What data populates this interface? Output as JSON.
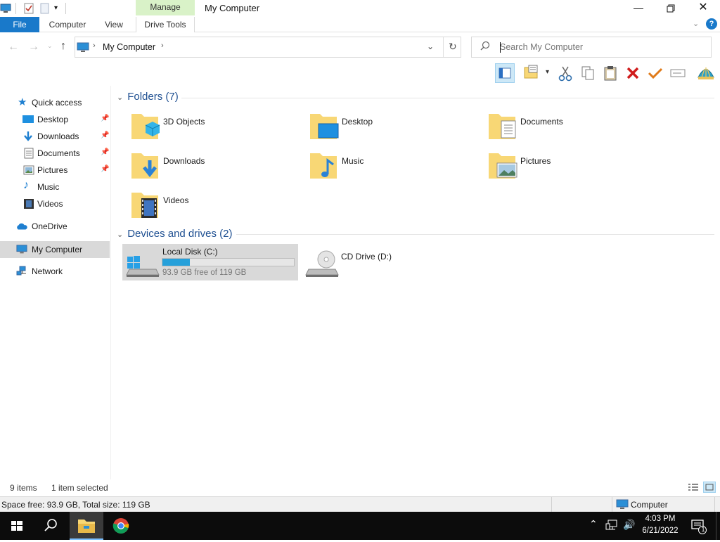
{
  "titlebar": {
    "context_tab": "Manage",
    "title": "My Computer"
  },
  "ribbon": {
    "file": "File",
    "tabs": [
      "Computer",
      "View",
      "Drive Tools"
    ]
  },
  "address": {
    "path": "My Computer",
    "search_placeholder": "Search My Computer"
  },
  "navpane": {
    "quick_access": "Quick access",
    "quick_items": [
      {
        "label": "Desktop",
        "pinned": true
      },
      {
        "label": "Downloads",
        "pinned": true
      },
      {
        "label": "Documents",
        "pinned": true
      },
      {
        "label": "Pictures",
        "pinned": true
      },
      {
        "label": "Music",
        "pinned": false
      },
      {
        "label": "Videos",
        "pinned": false
      }
    ],
    "onedrive": "OneDrive",
    "this_pc": "My Computer",
    "network": "Network"
  },
  "folders": {
    "header": "Folders (7)",
    "items": [
      "3D Objects",
      "Desktop",
      "Documents",
      "Downloads",
      "Music",
      "Pictures",
      "Videos"
    ]
  },
  "drives": {
    "header": "Devices and drives (2)",
    "local": {
      "label": "Local Disk (C:)",
      "free_text": "93.9 GB free of 119 GB",
      "used_fraction": 0.21
    },
    "cd": {
      "label": "CD Drive (D:)"
    }
  },
  "status": {
    "items": "9 items",
    "selected": "1 item selected"
  },
  "details": {
    "space": "Space free: 93.9 GB, Total size: 119 GB",
    "location": "Computer"
  },
  "taskbar": {
    "time": "4:03 PM",
    "date": "6/21/2022",
    "notification_count": "1"
  },
  "colors": {
    "accent": "#1979ca",
    "progress": "#26a0da",
    "folder": "#f8d775",
    "header_text": "#1e4f91"
  }
}
